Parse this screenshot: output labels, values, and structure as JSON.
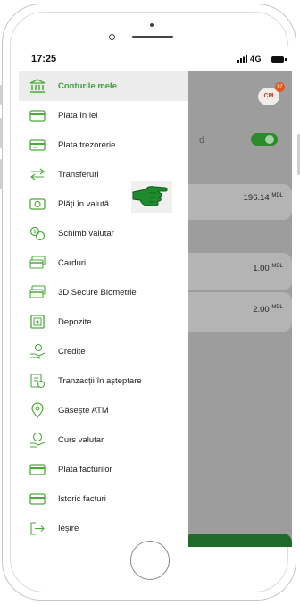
{
  "status_bar": {
    "time": "17:25",
    "network": "4G"
  },
  "header": {
    "avatar_initials": "CM",
    "notification_count": "67"
  },
  "background": {
    "partial_label": "d",
    "accounts": [
      {
        "amount": "196.14",
        "currency": "MDL"
      },
      {
        "amount": "1.00",
        "currency": "MDL"
      },
      {
        "amount": "2.00",
        "currency": "MDL"
      }
    ]
  },
  "menu": {
    "items": [
      {
        "label": "Conturile mele",
        "icon": "bank-icon",
        "active": true
      },
      {
        "label": "Plata în lei",
        "icon": "card-payment-icon"
      },
      {
        "label": "Plata trezorerie",
        "icon": "treasury-payment-icon"
      },
      {
        "label": "Transferuri",
        "icon": "transfer-arrows-icon"
      },
      {
        "label": "Plăți în valută",
        "icon": "currency-payment-icon"
      },
      {
        "label": "Schimb valutar",
        "icon": "currency-exchange-icon"
      },
      {
        "label": "Carduri",
        "icon": "cards-icon"
      },
      {
        "label": "3D Secure Biometrie",
        "icon": "secure-card-icon"
      },
      {
        "label": "Depozite",
        "icon": "deposit-icon"
      },
      {
        "label": "Credite",
        "icon": "credit-hand-icon"
      },
      {
        "label": "Tranzacții în așteptare",
        "icon": "pending-transactions-icon"
      },
      {
        "label": "Găsește ATM",
        "icon": "location-pin-icon"
      },
      {
        "label": "Curs valutar",
        "icon": "exchange-rate-icon"
      },
      {
        "label": "Plata facturilor",
        "icon": "bill-payment-icon"
      },
      {
        "label": "Istoric facturi",
        "icon": "bill-history-icon"
      },
      {
        "label": "Ieșire",
        "icon": "logout-icon"
      }
    ]
  },
  "colors": {
    "accent": "#3aa13a",
    "icon_green": "#4caa3c",
    "pointer_green": "#1f8a2e",
    "overlay": "#9d9d9d"
  }
}
